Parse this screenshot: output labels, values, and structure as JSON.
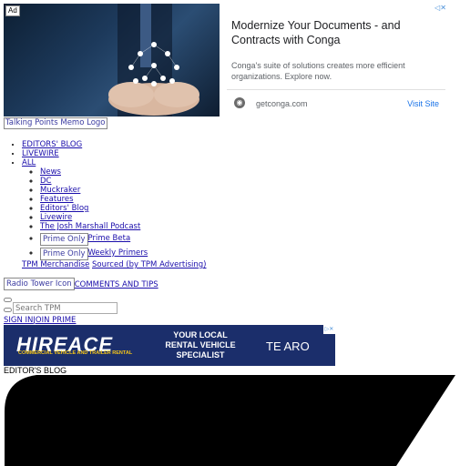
{
  "top_ad": {
    "badge": "Ad",
    "close_glyph": "◁✕",
    "headline": "Modernize Your Documents - and Contracts with Conga",
    "description": "Conga's suite of solutions creates more efficient organizations. Explore now.",
    "domain": "getconga.com",
    "cta": "Visit Site",
    "image_icon": "people-network-in-hands-image"
  },
  "logo": {
    "label": "Talking Points Memo Logo"
  },
  "nav": {
    "items": [
      {
        "label": "EDITORS' BLOG"
      },
      {
        "label": "LIVEWIRE"
      },
      {
        "label": "ALL"
      }
    ],
    "sub_items": [
      {
        "label": "News"
      },
      {
        "label": "DC"
      },
      {
        "label": "Muckraker"
      },
      {
        "label": "Features"
      },
      {
        "label": "Editors' Blog"
      },
      {
        "label": "Livewire"
      },
      {
        "label": "The Josh Marshall Podcast"
      }
    ],
    "prime_items": [
      {
        "badge": "Prime Only",
        "label": "Prime Beta"
      },
      {
        "badge": "Prime Only",
        "label": "Weekly Primers"
      }
    ]
  },
  "links": {
    "merch": "TPM Merchandise",
    "sourced": "Sourced (by TPM Advertising)"
  },
  "radio": {
    "icon_label": "Radio Tower Icon",
    "comments": "COMMENTS AND TIPS"
  },
  "search": {
    "placeholder": "Search TPM"
  },
  "account": {
    "sign_in": "SIGN IN",
    "join": "JOIN PRIME"
  },
  "banner_ad": {
    "logo": "HIREACE",
    "tagline": "COMMERCIAL VEHICLE AND TRAILER RENTAL",
    "middle": "YOUR LOCAL RENTAL VEHICLE SPECIALIST",
    "right": "TE ARO",
    "close_glyph": "▷✕"
  },
  "section": {
    "label": "EDITOR'S BLOG"
  }
}
